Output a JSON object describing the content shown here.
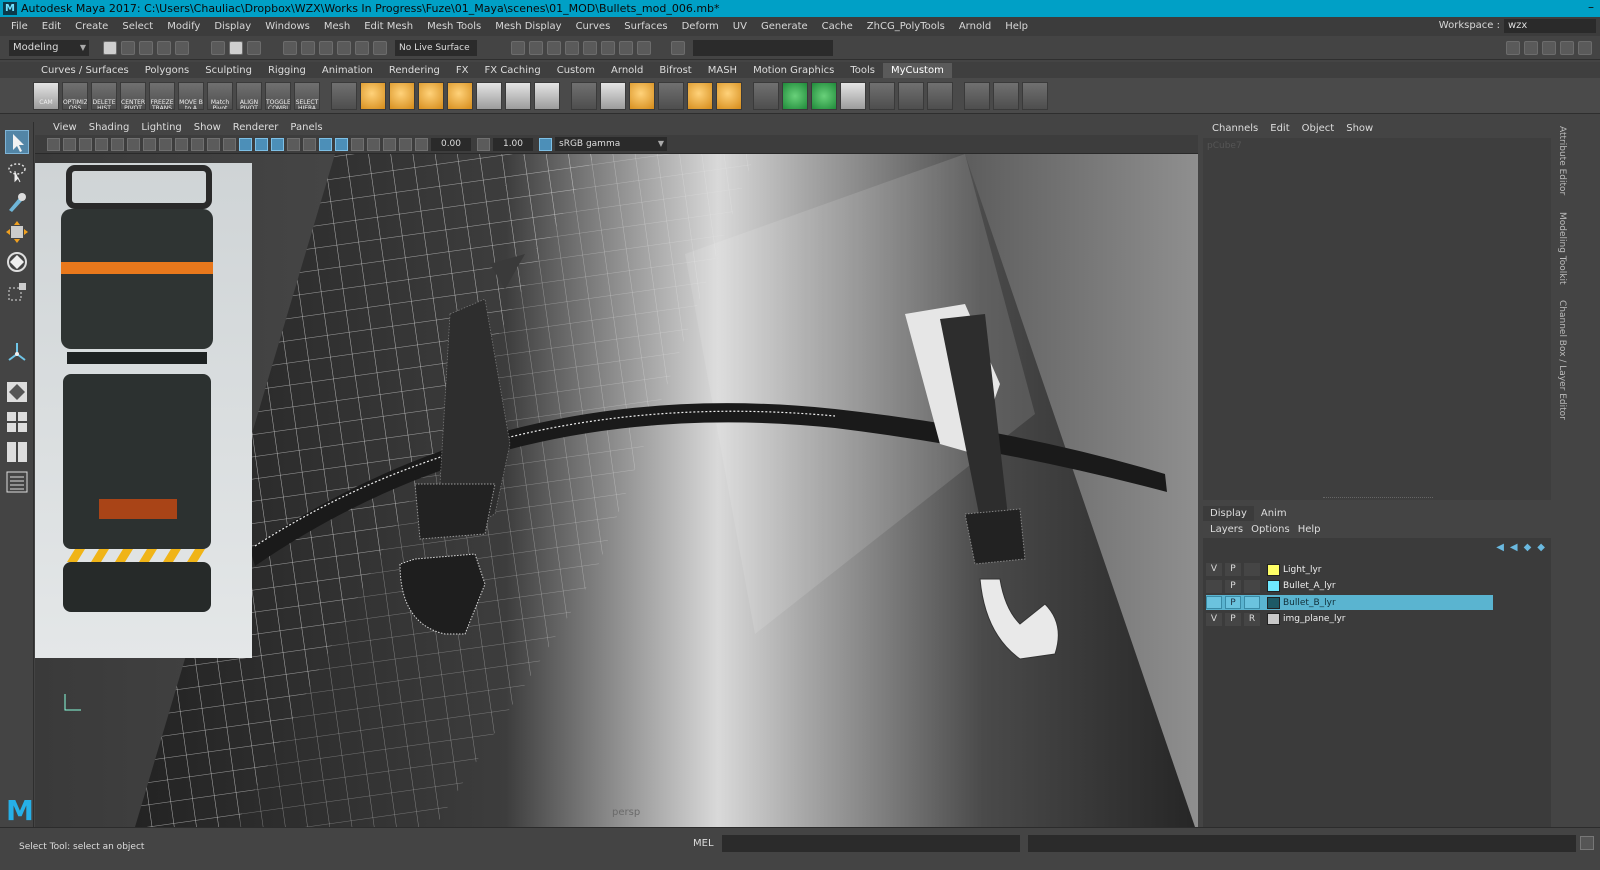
{
  "window": {
    "title": "Autodesk Maya 2017: C:\\Users\\Chauliac\\Dropbox\\WZX\\Works In Progress\\Fuze\\01_Maya\\scenes\\01_MOD\\Bullets_mod_006.mb*",
    "logo": "M",
    "minimize": "–"
  },
  "menus": [
    "File",
    "Edit",
    "Create",
    "Select",
    "Modify",
    "Display",
    "Windows",
    "Mesh",
    "Edit Mesh",
    "Mesh Tools",
    "Mesh Display",
    "Curves",
    "Surfaces",
    "Deform",
    "UV",
    "Generate",
    "Cache",
    "ZhCG_PolyTools",
    "Arnold",
    "Help"
  ],
  "workspace": {
    "label": "Workspace :",
    "value": "wzx"
  },
  "status": {
    "mode": "Modeling",
    "live_surface": "No Live Surface"
  },
  "shelf_tabs": [
    "Curves / Surfaces",
    "Polygons",
    "Sculpting",
    "Rigging",
    "Animation",
    "Rendering",
    "FX",
    "FX Caching",
    "Custom",
    "Arnold",
    "Bifrost",
    "MASH",
    "Motion Graphics",
    "Tools",
    "MyCustom"
  ],
  "shelf_active": "MyCustom",
  "shelf_buttons": [
    {
      "label": "CAM",
      "style": "plain"
    },
    {
      "label": "OPTIMIZ OSS",
      "style": ""
    },
    {
      "label": "DELETE HIST",
      "style": ""
    },
    {
      "label": "CENTER PIVOT",
      "style": ""
    },
    {
      "label": "FREEZE TRANS",
      "style": ""
    },
    {
      "label": "MOVE B to A",
      "style": ""
    },
    {
      "label": "Match Pivot",
      "style": ""
    },
    {
      "label": "ALIGN PIVOT",
      "style": ""
    },
    {
      "label": "TOGGLE COMBI",
      "style": ""
    },
    {
      "label": "SELECT HIERA",
      "style": ""
    },
    {
      "label": "",
      "style": ""
    },
    {
      "label": "",
      "style": "gold"
    },
    {
      "label": "",
      "style": "gold"
    },
    {
      "label": "",
      "style": "gold"
    },
    {
      "label": "",
      "style": "gold"
    },
    {
      "label": "",
      "style": "plain"
    },
    {
      "label": "",
      "style": "plain"
    },
    {
      "label": "",
      "style": "plain"
    },
    {
      "label": "",
      "style": ""
    },
    {
      "label": "",
      "style": "plain"
    },
    {
      "label": "",
      "style": "gold"
    },
    {
      "label": "",
      "style": ""
    },
    {
      "label": "",
      "style": "gold"
    },
    {
      "label": "",
      "style": "gold"
    },
    {
      "label": "",
      "style": ""
    },
    {
      "label": "",
      "style": "green"
    },
    {
      "label": "",
      "style": "green"
    },
    {
      "label": "",
      "style": "plain"
    },
    {
      "label": "",
      "style": ""
    },
    {
      "label": "",
      "style": ""
    },
    {
      "label": "",
      "style": ""
    },
    {
      "label": "",
      "style": ""
    },
    {
      "label": "",
      "style": ""
    },
    {
      "label": "",
      "style": ""
    }
  ],
  "panel_menu": [
    "View",
    "Shading",
    "Lighting",
    "Show",
    "Renderer",
    "Panels"
  ],
  "panel_toolbar": {
    "exposure": "0.00",
    "gamma": "1.00",
    "color_space": "sRGB gamma"
  },
  "viewport": {
    "camera_label": "persp"
  },
  "channel_box": {
    "menu": [
      "Channels",
      "Edit",
      "Object",
      "Show"
    ],
    "object": "pCube7"
  },
  "layer_editor": {
    "tabs": [
      "Display",
      "Anim"
    ],
    "menu": [
      "Layers",
      "Options",
      "Help"
    ],
    "layers": [
      {
        "v": "V",
        "p": "P",
        "r": "",
        "name": "Light_lyr",
        "color": "#ffff66",
        "selected": false
      },
      {
        "v": "",
        "p": "P",
        "r": "",
        "name": "Bullet_A_lyr",
        "color": "#6fe8ff",
        "selected": false
      },
      {
        "v": "",
        "p": "P",
        "r": "",
        "name": "Bullet_B_lyr",
        "color": "#1d5a66",
        "selected": true
      },
      {
        "v": "V",
        "p": "P",
        "r": "R",
        "name": "img_plane_lyr",
        "color": "#c8c8c8",
        "selected": false
      }
    ]
  },
  "side_tabs": [
    "Attribute Editor",
    "Modeling Toolkit",
    "Channel Box / Layer Editor"
  ],
  "help_line": "Select Tool: select an object",
  "command_line": {
    "language": "MEL"
  }
}
